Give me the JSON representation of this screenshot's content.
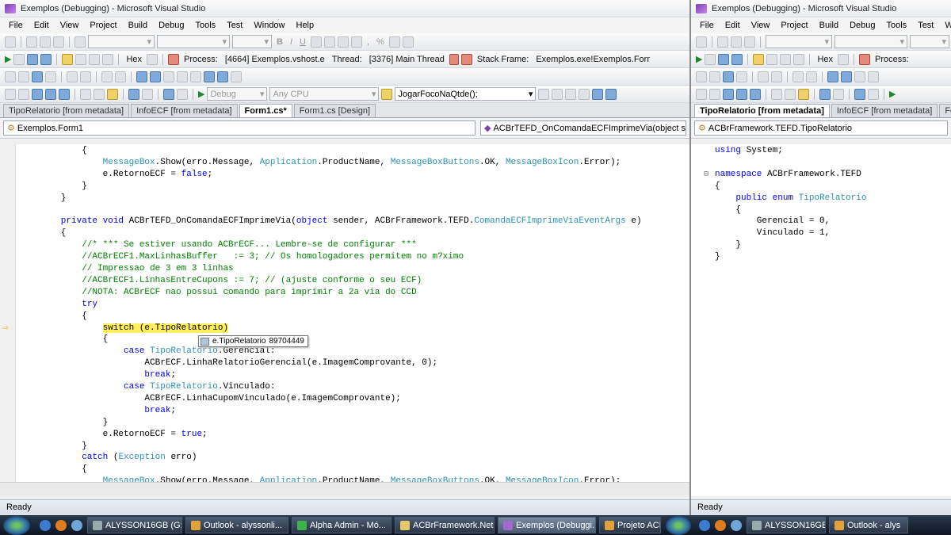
{
  "left": {
    "title": "Exemplos (Debugging) - Microsoft Visual Studio",
    "menu": [
      "File",
      "Edit",
      "View",
      "Project",
      "Build",
      "Debug",
      "Tools",
      "Test",
      "Window",
      "Help"
    ],
    "debug_toolbar": {
      "hex": "Hex",
      "process_label": "Process:",
      "process_value": "[4664] Exemplos.vshost.e",
      "thread_label": "Thread:",
      "thread_value": "[3376] Main Thread",
      "stack_label": "Stack Frame:",
      "stack_value": "Exemplos.exe!Exemplos.Forr"
    },
    "standard_toolbar": {
      "config": "Debug",
      "platform": "Any CPU",
      "find": "JogarFocoNaQtde();"
    },
    "tabs": [
      "TipoRelatorio [from metadata]",
      "InfoECF [from metadata]",
      "Form1.cs*",
      "Form1.cs [Design]"
    ],
    "nav": {
      "class": "Exemplos.Form1",
      "member": "ACBrTEFD_OnComandaECFImprimeVia(object sender"
    },
    "tooltip": {
      "name": "e.TipoRelatorio",
      "value": "89704449"
    },
    "status": "Ready"
  },
  "right": {
    "title": "Exemplos (Debugging) - Microsoft Visual Studio",
    "menu": [
      "File",
      "Edit",
      "View",
      "Project",
      "Build",
      "Debug",
      "Tools",
      "Test",
      "Windo"
    ],
    "debug_toolbar": {
      "hex": "Hex",
      "process_label": "Process:"
    },
    "tabs": [
      "TipoRelatorio [from metadata]",
      "InfoECF [from metadata]",
      "Fo"
    ],
    "nav": {
      "class": "ACBrFramework.TEFD.TipoRelatorio"
    },
    "status": "Ready"
  },
  "code_left": [
    [
      [
        "p",
        "            {"
      ]
    ],
    [
      [
        "p",
        "                "
      ],
      [
        "ty",
        "MessageBox"
      ],
      [
        "p",
        ".Show(erro.Message, "
      ],
      [
        "ty",
        "Application"
      ],
      [
        "p",
        ".ProductName, "
      ],
      [
        "ty",
        "MessageBoxButtons"
      ],
      [
        "p",
        ".OK, "
      ],
      [
        "ty",
        "MessageBoxIcon"
      ],
      [
        "p",
        ".Error);"
      ]
    ],
    [
      [
        "p",
        "                e.RetornoECF = "
      ],
      [
        "kw",
        "false"
      ],
      [
        "p",
        ";"
      ]
    ],
    [
      [
        "p",
        "            }"
      ]
    ],
    [
      [
        "p",
        "        }"
      ]
    ],
    [
      [
        "p",
        ""
      ]
    ],
    [
      [
        "kw",
        "        private void "
      ],
      [
        "p",
        "ACBrTEFD_OnComandaECFImprimeVia("
      ],
      [
        "kw",
        "object"
      ],
      [
        "p",
        " sender, ACBrFramework.TEFD."
      ],
      [
        "ty",
        "ComandaECFImprimeViaEventArgs"
      ],
      [
        "p",
        " e)"
      ]
    ],
    [
      [
        "p",
        "        {"
      ]
    ],
    [
      [
        "cm",
        "            //* *** Se estiver usando ACBrECF... Lembre-se de configurar ***"
      ]
    ],
    [
      [
        "cm",
        "            //ACBrECF1.MaxLinhasBuffer   := 3; // Os homologadores permitem no m?ximo"
      ]
    ],
    [
      [
        "cm",
        "            // Impressao de 3 em 3 linhas"
      ]
    ],
    [
      [
        "cm",
        "            //ACBrECF1.LinhasEntreCupons := 7; // (ajuste conforme o seu ECF)"
      ]
    ],
    [
      [
        "cm",
        "            //NOTA: ACBrECF nao possui comando para imprimir a 2a via do CCD"
      ]
    ],
    [
      [
        "kw",
        "            try"
      ]
    ],
    [
      [
        "p",
        "            {"
      ]
    ],
    [
      [
        "p",
        "                "
      ],
      [
        "hl",
        "switch (e.TipoRelatorio)"
      ]
    ],
    [
      [
        "p",
        "                {"
      ]
    ],
    [
      [
        "kw",
        "                    case "
      ],
      [
        "ty",
        "TipoRelatorio"
      ],
      [
        "p",
        ".Gerencial:"
      ]
    ],
    [
      [
        "p",
        "                        ACBrECF.LinhaRelatorioGerencial(e.ImagemComprovante, 0);"
      ]
    ],
    [
      [
        "kw",
        "                        break"
      ],
      [
        "p",
        ";"
      ]
    ],
    [
      [
        "kw",
        "                    case "
      ],
      [
        "ty",
        "TipoRelatorio"
      ],
      [
        "p",
        ".Vinculado:"
      ]
    ],
    [
      [
        "p",
        "                        ACBrECF.LinhaCupomVinculado(e.ImagemComprovante);"
      ]
    ],
    [
      [
        "kw",
        "                        break"
      ],
      [
        "p",
        ";"
      ]
    ],
    [
      [
        "p",
        "                }"
      ]
    ],
    [
      [
        "p",
        "                e.RetornoECF = "
      ],
      [
        "kw",
        "true"
      ],
      [
        "p",
        ";"
      ]
    ],
    [
      [
        "p",
        "            }"
      ]
    ],
    [
      [
        "kw",
        "            catch "
      ],
      [
        "p",
        "("
      ],
      [
        "ty",
        "Exception"
      ],
      [
        "p",
        " erro)"
      ]
    ],
    [
      [
        "p",
        "            {"
      ]
    ],
    [
      [
        "p",
        "                "
      ],
      [
        "ty",
        "MessageBox"
      ],
      [
        "p",
        ".Show(erro.Message, "
      ],
      [
        "ty",
        "Application"
      ],
      [
        "p",
        ".ProductName, "
      ],
      [
        "ty",
        "MessageBoxButtons"
      ],
      [
        "p",
        ".OK, "
      ],
      [
        "ty",
        "MessageBoxIcon"
      ],
      [
        "p",
        ".Error);"
      ]
    ]
  ],
  "code_right": [
    [
      [
        "kw",
        "using "
      ],
      [
        "p",
        "System;"
      ]
    ],
    [
      [
        "p",
        ""
      ]
    ],
    [
      [
        "kw",
        "namespace "
      ],
      [
        "p",
        "ACBrFramework.TEFD"
      ]
    ],
    [
      [
        "p",
        "{"
      ]
    ],
    [
      [
        "kw",
        "    public enum "
      ],
      [
        "ty",
        "TipoRelatorio"
      ]
    ],
    [
      [
        "p",
        "    {"
      ]
    ],
    [
      [
        "p",
        "        Gerencial = 0,"
      ]
    ],
    [
      [
        "p",
        "        Vinculado = 1,"
      ]
    ],
    [
      [
        "p",
        "    }"
      ]
    ],
    [
      [
        "p",
        "}"
      ]
    ]
  ],
  "taskbar": {
    "items": [
      "ALYSSON16GB (G:)",
      "Outlook - alyssonli...",
      "Alpha Admin - Mó...",
      "ACBrFramework.Net",
      "Exemplos (Debuggi...",
      "Projeto ACI"
    ],
    "items_right": [
      "ALYSSON16GB",
      "Outlook - alys"
    ]
  },
  "colors": {
    "keyword": "#0000ff",
    "type": "#2b91af",
    "comment": "#008000",
    "highlight": "#ffef5e"
  }
}
